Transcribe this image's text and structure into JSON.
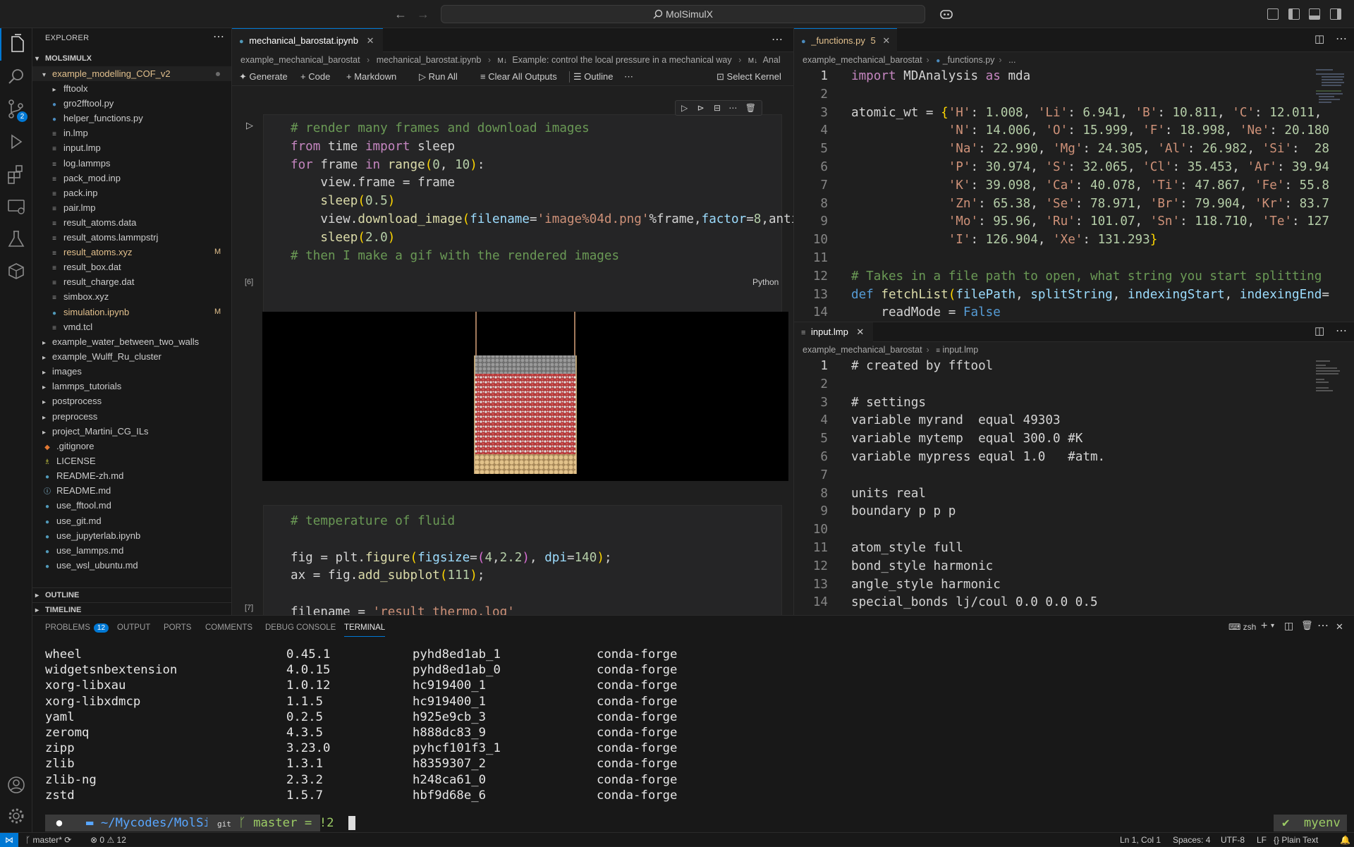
{
  "titlebar": {
    "search_text": "MolSimulX",
    "nav_back": "←",
    "nav_forward": "→"
  },
  "activity": {
    "source_control_badge": "2"
  },
  "sidebar": {
    "title": "EXPLORER",
    "root": "MOLSIMULX",
    "folder": "example_modelling_COF_v2",
    "files": [
      {
        "name": "fftoolx",
        "kind": "folder-closed",
        "mod": "",
        "color": "#cccccc"
      },
      {
        "name": "gro2fftool.py",
        "kind": "py",
        "mod": "",
        "color": "#cccccc"
      },
      {
        "name": "helper_functions.py",
        "kind": "py",
        "mod": "",
        "color": "#cccccc"
      },
      {
        "name": "in.lmp",
        "kind": "txt",
        "mod": "",
        "color": "#cccccc"
      },
      {
        "name": "input.lmp",
        "kind": "txt",
        "mod": "",
        "color": "#cccccc"
      },
      {
        "name": "log.lammps",
        "kind": "txt",
        "mod": "",
        "color": "#cccccc"
      },
      {
        "name": "pack_mod.inp",
        "kind": "txt",
        "mod": "",
        "color": "#cccccc"
      },
      {
        "name": "pack.inp",
        "kind": "txt",
        "mod": "",
        "color": "#cccccc"
      },
      {
        "name": "pair.lmp",
        "kind": "txt",
        "mod": "",
        "color": "#cccccc"
      },
      {
        "name": "result_atoms.data",
        "kind": "txt",
        "mod": "",
        "color": "#cccccc"
      },
      {
        "name": "result_atoms.lammpstrj",
        "kind": "txt",
        "mod": "",
        "color": "#cccccc"
      },
      {
        "name": "result_atoms.xyz",
        "kind": "txt",
        "mod": "M",
        "color": "#e2c08d"
      },
      {
        "name": "result_box.dat",
        "kind": "txt",
        "mod": "",
        "color": "#cccccc"
      },
      {
        "name": "result_charge.dat",
        "kind": "txt",
        "mod": "",
        "color": "#cccccc"
      },
      {
        "name": "simbox.xyz",
        "kind": "txt",
        "mod": "",
        "color": "#cccccc"
      },
      {
        "name": "simulation.ipynb",
        "kind": "nb",
        "mod": "M",
        "color": "#e2c08d"
      },
      {
        "name": "vmd.tcl",
        "kind": "txt",
        "mod": "",
        "color": "#cccccc"
      }
    ],
    "folders": [
      "example_water_between_two_walls",
      "example_Wulff_Ru_cluster",
      "images",
      "lammps_tutorials",
      "postprocess",
      "preprocess",
      "project_Martini_CG_ILs"
    ],
    "rootfiles": [
      {
        "name": ".gitignore",
        "kind": "git"
      },
      {
        "name": "LICENSE",
        "kind": "lic"
      },
      {
        "name": "README-zh.md",
        "kind": "md"
      },
      {
        "name": "README.md",
        "kind": "info"
      },
      {
        "name": "use_fftool.md",
        "kind": "md"
      },
      {
        "name": "use_git.md",
        "kind": "md"
      },
      {
        "name": "use_jupyterlab.ipynb",
        "kind": "nb"
      },
      {
        "name": "use_lammps.md",
        "kind": "md"
      },
      {
        "name": "use_wsl_ubuntu.md",
        "kind": "md"
      }
    ],
    "outline": "OUTLINE",
    "timeline": "TIMELINE"
  },
  "notebook": {
    "tab": "mechanical_barostat.ipynb",
    "breadcrumb": [
      "example_mechanical_barostat",
      "mechanical_barostat.ipynb",
      "Example: control the local pressure in a mechanical way",
      "Anal"
    ],
    "toolbar": {
      "generate": "Generate",
      "code": "Code",
      "markdown": "Markdown",
      "run_all": "Run All",
      "clear": "Clear All Outputs",
      "outline": "Outline",
      "more": "⋯",
      "kernel": "Select Kernel"
    },
    "cell1": {
      "exec": "[6]",
      "lang": "Python"
    },
    "cell2": {
      "exec": "[7]"
    }
  },
  "pyfile": {
    "tab": "_functions.py",
    "tab_count": "5",
    "breadcrumb": [
      "example_mechanical_barostat",
      "_functions.py",
      "..."
    ],
    "line_numbers": [
      "1",
      "2",
      "3",
      "4",
      "5",
      "6",
      "7",
      "8",
      "9",
      "10",
      "11",
      "12",
      "13",
      "14"
    ]
  },
  "lmpfile": {
    "tab": "input.lmp",
    "breadcrumb": [
      "example_mechanical_barostat",
      "input.lmp"
    ],
    "line_numbers": [
      "1",
      "2",
      "3",
      "4",
      "5",
      "6",
      "7",
      "8",
      "9",
      "10",
      "11",
      "12",
      "13",
      "14"
    ]
  },
  "panel": {
    "tabs": [
      "PROBLEMS",
      "OUTPUT",
      "PORTS",
      "COMMENTS",
      "DEBUG CONSOLE",
      "TERMINAL"
    ],
    "problems_badge": "12",
    "shell": "zsh",
    "rows": [
      [
        "wheel",
        "0.45.1",
        "pyhd8ed1ab_1",
        "conda-forge"
      ],
      [
        "widgetsnbextension",
        "4.0.15",
        "pyhd8ed1ab_0",
        "conda-forge"
      ],
      [
        "xorg-libxau",
        "1.0.12",
        "hc919400_1",
        "conda-forge"
      ],
      [
        "xorg-libxdmcp",
        "1.1.5",
        "hc919400_1",
        "conda-forge"
      ],
      [
        "yaml",
        "0.2.5",
        "h925e9cb_3",
        "conda-forge"
      ],
      [
        "zeromq",
        "4.3.5",
        "h888dc83_9",
        "conda-forge"
      ],
      [
        "zipp",
        "3.23.0",
        "pyhcf101f3_1",
        "conda-forge"
      ],
      [
        "zlib",
        "1.3.1",
        "h8359307_2",
        "conda-forge"
      ],
      [
        "zlib-ng",
        "2.3.2",
        "h248ca61_0",
        "conda-forge"
      ],
      [
        "zstd",
        "1.5.7",
        "hbf9d68e_6",
        "conda-forge"
      ]
    ],
    "prompt_path": "~/Mycodes/MolSimulX",
    "prompt_git": "git",
    "prompt_branch": "master = !2",
    "prompt_check": "✔",
    "prompt_env": "myenv"
  },
  "status": {
    "branch": "master*",
    "errors": "0",
    "warnings": "12",
    "position": "Ln 1, Col 1",
    "spaces": "Spaces: 4",
    "encoding": "UTF-8",
    "eol": "LF",
    "lang": "Plain Text"
  }
}
